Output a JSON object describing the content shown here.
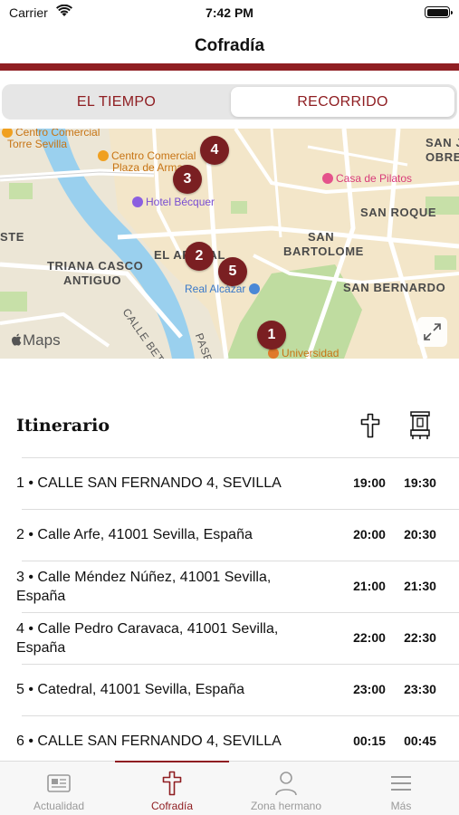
{
  "status_bar": {
    "carrier": "Carrier",
    "time": "7:42 PM"
  },
  "nav": {
    "title": "Cofradía"
  },
  "segments": {
    "left": "EL TIEMPO",
    "right": "RECORRIDO",
    "selected": "RECORRIDO"
  },
  "map": {
    "labels": {
      "cc_torre_1": "Centro Comercial",
      "cc_torre_2": "Torre Sevilla",
      "cc_plaza_1": "Centro Comercial",
      "cc_plaza_2": "Plaza de Armas",
      "san_juan_1": "SAN JUAN",
      "san_juan_2": "OBRE",
      "casa_pilatos": "Casa de Pilatos",
      "hotel": "Hotel Bécquer",
      "san_roque": "SAN ROQUE",
      "ste": "STE",
      "el_arenal": "EL ARENAL",
      "san_bartolome_1": "SAN",
      "san_bartolome_2": "BARTOLOME",
      "triana_1": "TRIANA CASCO",
      "triana_2": "ANTIGUO",
      "real_alcazar": "Real Alcázar",
      "san_bernardo": "SAN BERNARDO",
      "calle_betis": "CALLE BETIS",
      "paseo": "PASE",
      "universidad": "Universidad"
    },
    "pins": [
      "1",
      "2",
      "3",
      "4",
      "5"
    ],
    "attribution": "Maps"
  },
  "itinerary": {
    "title": "Itinerario",
    "rows": [
      {
        "address": "1 • CALLE SAN FERNANDO 4, SEVILLA",
        "t1": "19:00",
        "t2": "19:30"
      },
      {
        "address": "2 • Calle Arfe, 41001 Sevilla, España",
        "t1": "20:00",
        "t2": "20:30"
      },
      {
        "address": "3 • Calle Méndez Núñez, 41001 Sevilla, España",
        "t1": "21:00",
        "t2": "21:30"
      },
      {
        "address": "4 • Calle Pedro Caravaca, 41001 Sevilla, España",
        "t1": "22:00",
        "t2": "22:30"
      },
      {
        "address": "5 • Catedral, 41001 Sevilla, España",
        "t1": "23:00",
        "t2": "23:30"
      },
      {
        "address": "6 • CALLE SAN FERNANDO 4, SEVILLA",
        "t1": "00:15",
        "t2": "00:45"
      }
    ]
  },
  "tabs": [
    {
      "label": "Actualidad",
      "icon": "newspaper-icon"
    },
    {
      "label": "Cofradía",
      "icon": "cross-icon"
    },
    {
      "label": "Zona hermano",
      "icon": "person-icon"
    },
    {
      "label": "Más",
      "icon": "menu-icon"
    }
  ],
  "colors": {
    "accent": "#8f1e22",
    "pin": "#7a1f22"
  }
}
